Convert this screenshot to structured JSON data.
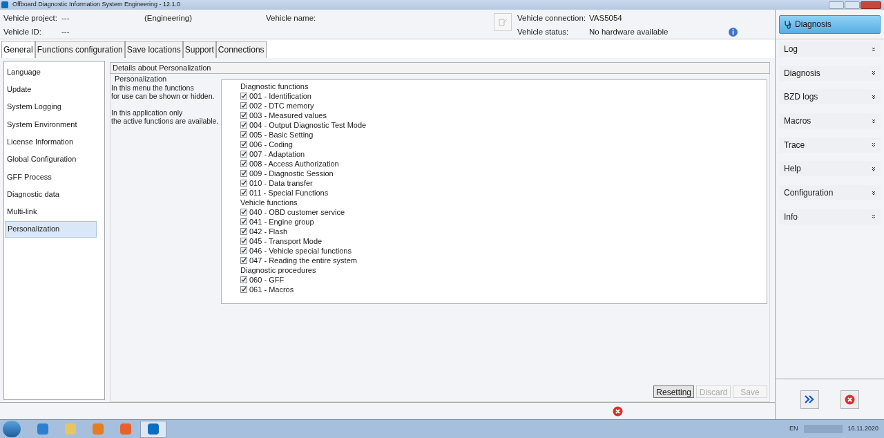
{
  "window": {
    "title": "Offboard Diagnostic Information System Engineering - 12.1.0"
  },
  "header": {
    "vehicle_project_label": "Vehicle project:",
    "vehicle_project": "---",
    "edition": "(Engineering)",
    "vehicle_name_label": "Vehicle name:",
    "vehicle_id_label": "Vehicle ID:",
    "vehicle_id": "---",
    "connection_label": "Vehicle connection:",
    "connection": "VAS5054",
    "status_label": "Vehicle status:",
    "status": "No hardware available"
  },
  "tabs": [
    {
      "label": "General",
      "selected": true
    },
    {
      "label": "Functions configuration",
      "selected": false
    },
    {
      "label": "Save locations",
      "selected": false
    },
    {
      "label": "Support",
      "selected": false
    },
    {
      "label": "Connections",
      "selected": false
    }
  ],
  "sidebar": {
    "items": [
      {
        "label": "Language",
        "selected": false
      },
      {
        "label": "Update",
        "selected": false
      },
      {
        "label": "System Logging",
        "selected": false
      },
      {
        "label": "System Environment",
        "selected": false
      },
      {
        "label": "License Information",
        "selected": false
      },
      {
        "label": "Global Configuration",
        "selected": false
      },
      {
        "label": "GFF Process",
        "selected": false
      },
      {
        "label": "Diagnostic data",
        "selected": false
      },
      {
        "label": "Multi-link",
        "selected": false
      },
      {
        "label": "Personalization",
        "selected": true
      }
    ]
  },
  "content": {
    "title": "Details about Personalization",
    "group_title": "Personalization",
    "description": [
      [
        "In this menu the functions",
        "for use can be shown or hidden."
      ],
      [
        "In this application only",
        "the active functions are available."
      ]
    ],
    "groups": [
      {
        "title": "Diagnostic functions",
        "items": [
          {
            "label": "001 - Identification",
            "checked": true
          },
          {
            "label": "002 - DTC memory",
            "checked": true
          },
          {
            "label": "003 - Measured values",
            "checked": true
          },
          {
            "label": "004 - Output Diagnostic Test Mode",
            "checked": true
          },
          {
            "label": "005 - Basic Setting",
            "checked": true
          },
          {
            "label": "006 - Coding",
            "checked": true
          },
          {
            "label": "007 - Adaptation",
            "checked": true
          },
          {
            "label": "008 - Access Authorization",
            "checked": true
          },
          {
            "label": "009 - Diagnostic Session",
            "checked": true
          },
          {
            "label": "010 - Data transfer",
            "checked": true
          },
          {
            "label": "011 - Special Functions",
            "checked": true
          }
        ]
      },
      {
        "title": "Vehicle functions",
        "items": [
          {
            "label": "040 - OBD customer service",
            "checked": true
          },
          {
            "label": "041 - Engine group",
            "checked": true
          },
          {
            "label": "042 - Flash",
            "checked": true
          },
          {
            "label": "045 - Transport Mode",
            "checked": true
          },
          {
            "label": "046 - Vehicle special functions",
            "checked": true
          },
          {
            "label": "047 - Reading the entire system",
            "checked": true
          }
        ]
      },
      {
        "title": "Diagnostic procedures",
        "items": [
          {
            "label": "060 - GFF",
            "checked": true
          },
          {
            "label": "061 - Macros",
            "checked": true
          }
        ]
      }
    ],
    "buttons": [
      {
        "label": "Resetting",
        "disabled": false
      },
      {
        "label": "Discard",
        "disabled": true
      },
      {
        "label": "Save",
        "disabled": true
      }
    ]
  },
  "right_panel": {
    "mode_button": "Diagnosis",
    "sections": [
      "Log",
      "Diagnosis",
      "BZD logs",
      "Macros",
      "Trace",
      "Help",
      "Configuration",
      "Info"
    ]
  },
  "taskbar": {
    "language": "EN",
    "date": "16.11.2020"
  }
}
